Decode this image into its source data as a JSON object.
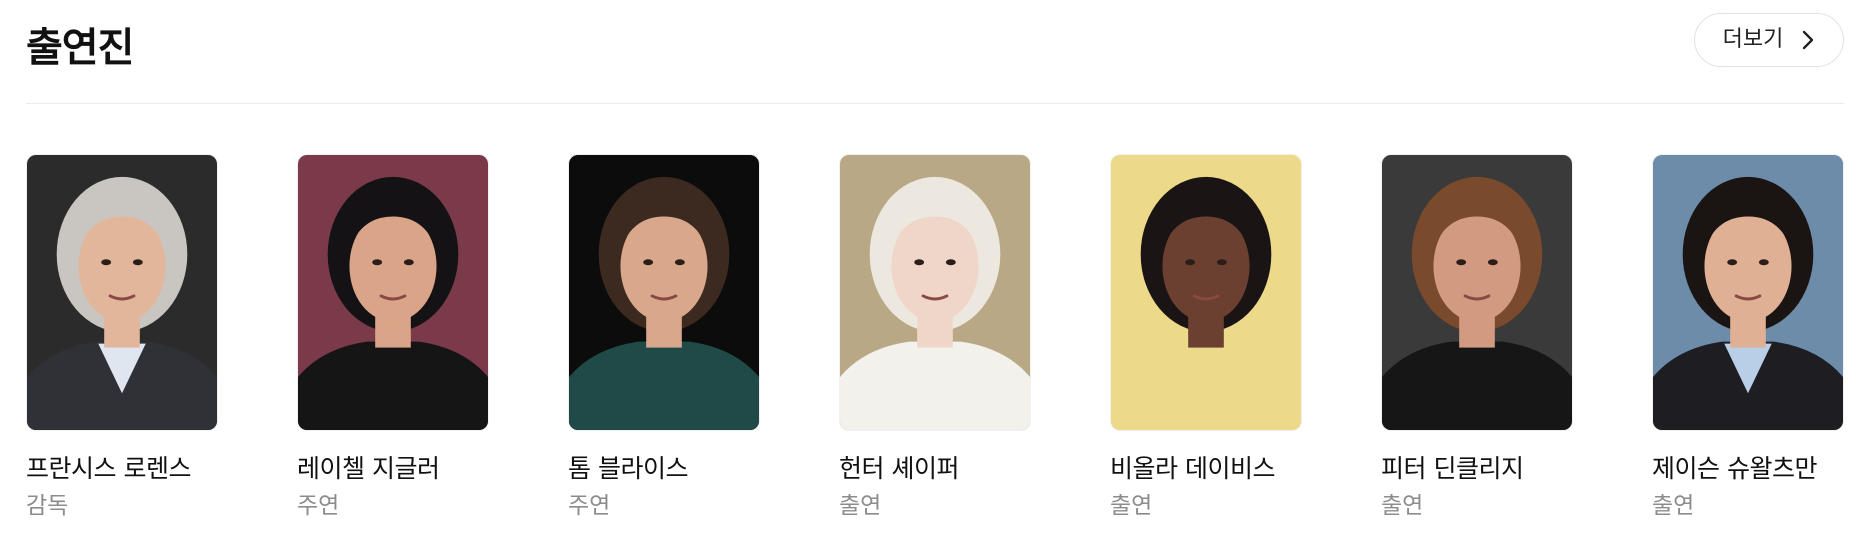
{
  "section": {
    "title": "출연진",
    "more_label": "더보기"
  },
  "cast": [
    {
      "name": "프란시스 로렌스",
      "role": "감독",
      "bg": "#2b2b2b",
      "skin": "#e2b69a",
      "hair": "#c9c5c0",
      "shirt": "#dfe6ef",
      "jacket": "#2f3137"
    },
    {
      "name": "레이첼 지글러",
      "role": "주연",
      "bg": "#7a3a4a",
      "skin": "#d9a487",
      "hair": "#141214",
      "shirt": "#151515",
      "jacket": "#151515"
    },
    {
      "name": "톰 블라이스",
      "role": "주연",
      "bg": "#0c0c0c",
      "skin": "#d9a88c",
      "hair": "#3c2a20",
      "shirt": "#1f4a47",
      "jacket": "#1f4a47"
    },
    {
      "name": "헌터 셰이퍼",
      "role": "출연",
      "bg": "#b9a886",
      "skin": "#efd6c8",
      "hair": "#ece8e0",
      "shirt": "#f3f1ec",
      "jacket": "#f3f1ec"
    },
    {
      "name": "비올라 데이비스",
      "role": "출연",
      "bg": "#ecd98a",
      "skin": "#6b4030",
      "hair": "#1a1514",
      "shirt": "#ecd98a",
      "jacket": "#ecd98a"
    },
    {
      "name": "피터 딘클리지",
      "role": "출연",
      "bg": "#3a3a3a",
      "skin": "#d39a82",
      "hair": "#7a4a2c",
      "shirt": "#161616",
      "jacket": "#161616"
    },
    {
      "name": "제이슨 슈왈츠만",
      "role": "출연",
      "bg": "#6d8caa",
      "skin": "#e0b094",
      "hair": "#1a1412",
      "shirt": "#b9cfe8",
      "jacket": "#1d1d22"
    }
  ]
}
